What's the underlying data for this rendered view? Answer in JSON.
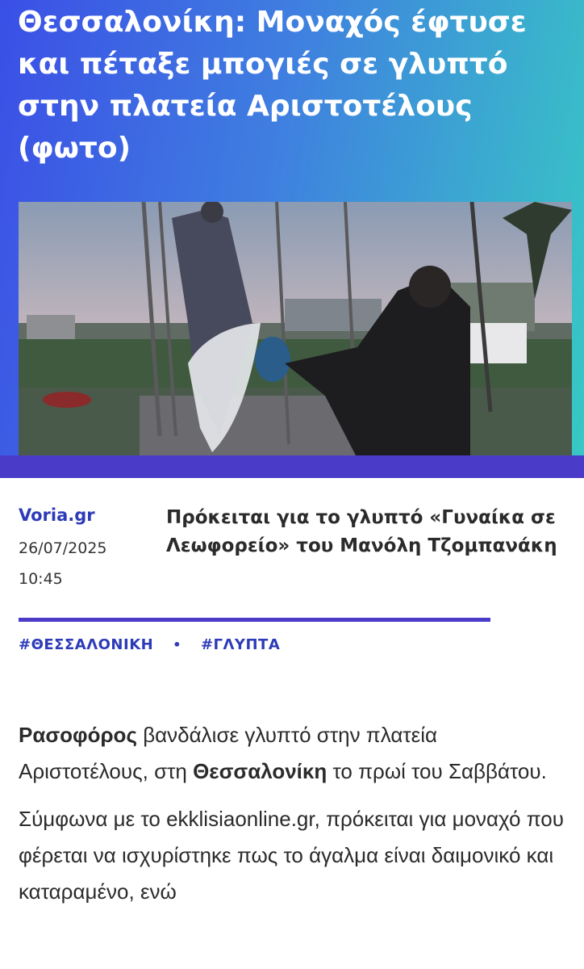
{
  "article": {
    "title": "Θεσσαλονίκη: Μοναχός έφτυσε και πέταξε μπογιές σε γλυπτό στην πλατεία Αριστοτέλους (φωτο)",
    "source": "Voria.gr",
    "date": "26/07/2025",
    "time": "10:45",
    "subtitle": "Πρόκειται για το γλυπτό «Γυναίκα σε Λεωφορείο» του Μανόλη Τζομπανάκη",
    "tags": [
      "#ΘΕΣΣΑΛΟΝΙΚΗ",
      "#ΓΛΥΠΤΑ"
    ],
    "tag_separator": "•",
    "body": {
      "p1_bold_1": "Ρασοφόρος",
      "p1_text_1": " βανδάλισε γλυπτό στην πλατεία Αριστοτέλους, στη ",
      "p1_bold_2": "Θεσσαλονίκη",
      "p1_text_2": " το πρωί του Σαββάτου.",
      "p2": "Σύμφωνα με το ekklisiaonline.gr, πρόκειται για μοναχό που φέρεται να ισχυρίστηκε πως το άγαλμα είναι δαιμονικό και καταραμένο, ενώ"
    }
  },
  "colors": {
    "accent": "#4a3cc9",
    "link": "#2d3bb8",
    "hero_gradient_start": "#3b4fe6",
    "hero_gradient_end": "#38c9c4"
  },
  "icons": {
    "photo": "photo-of-monk-throwing-paint-on-statue"
  }
}
